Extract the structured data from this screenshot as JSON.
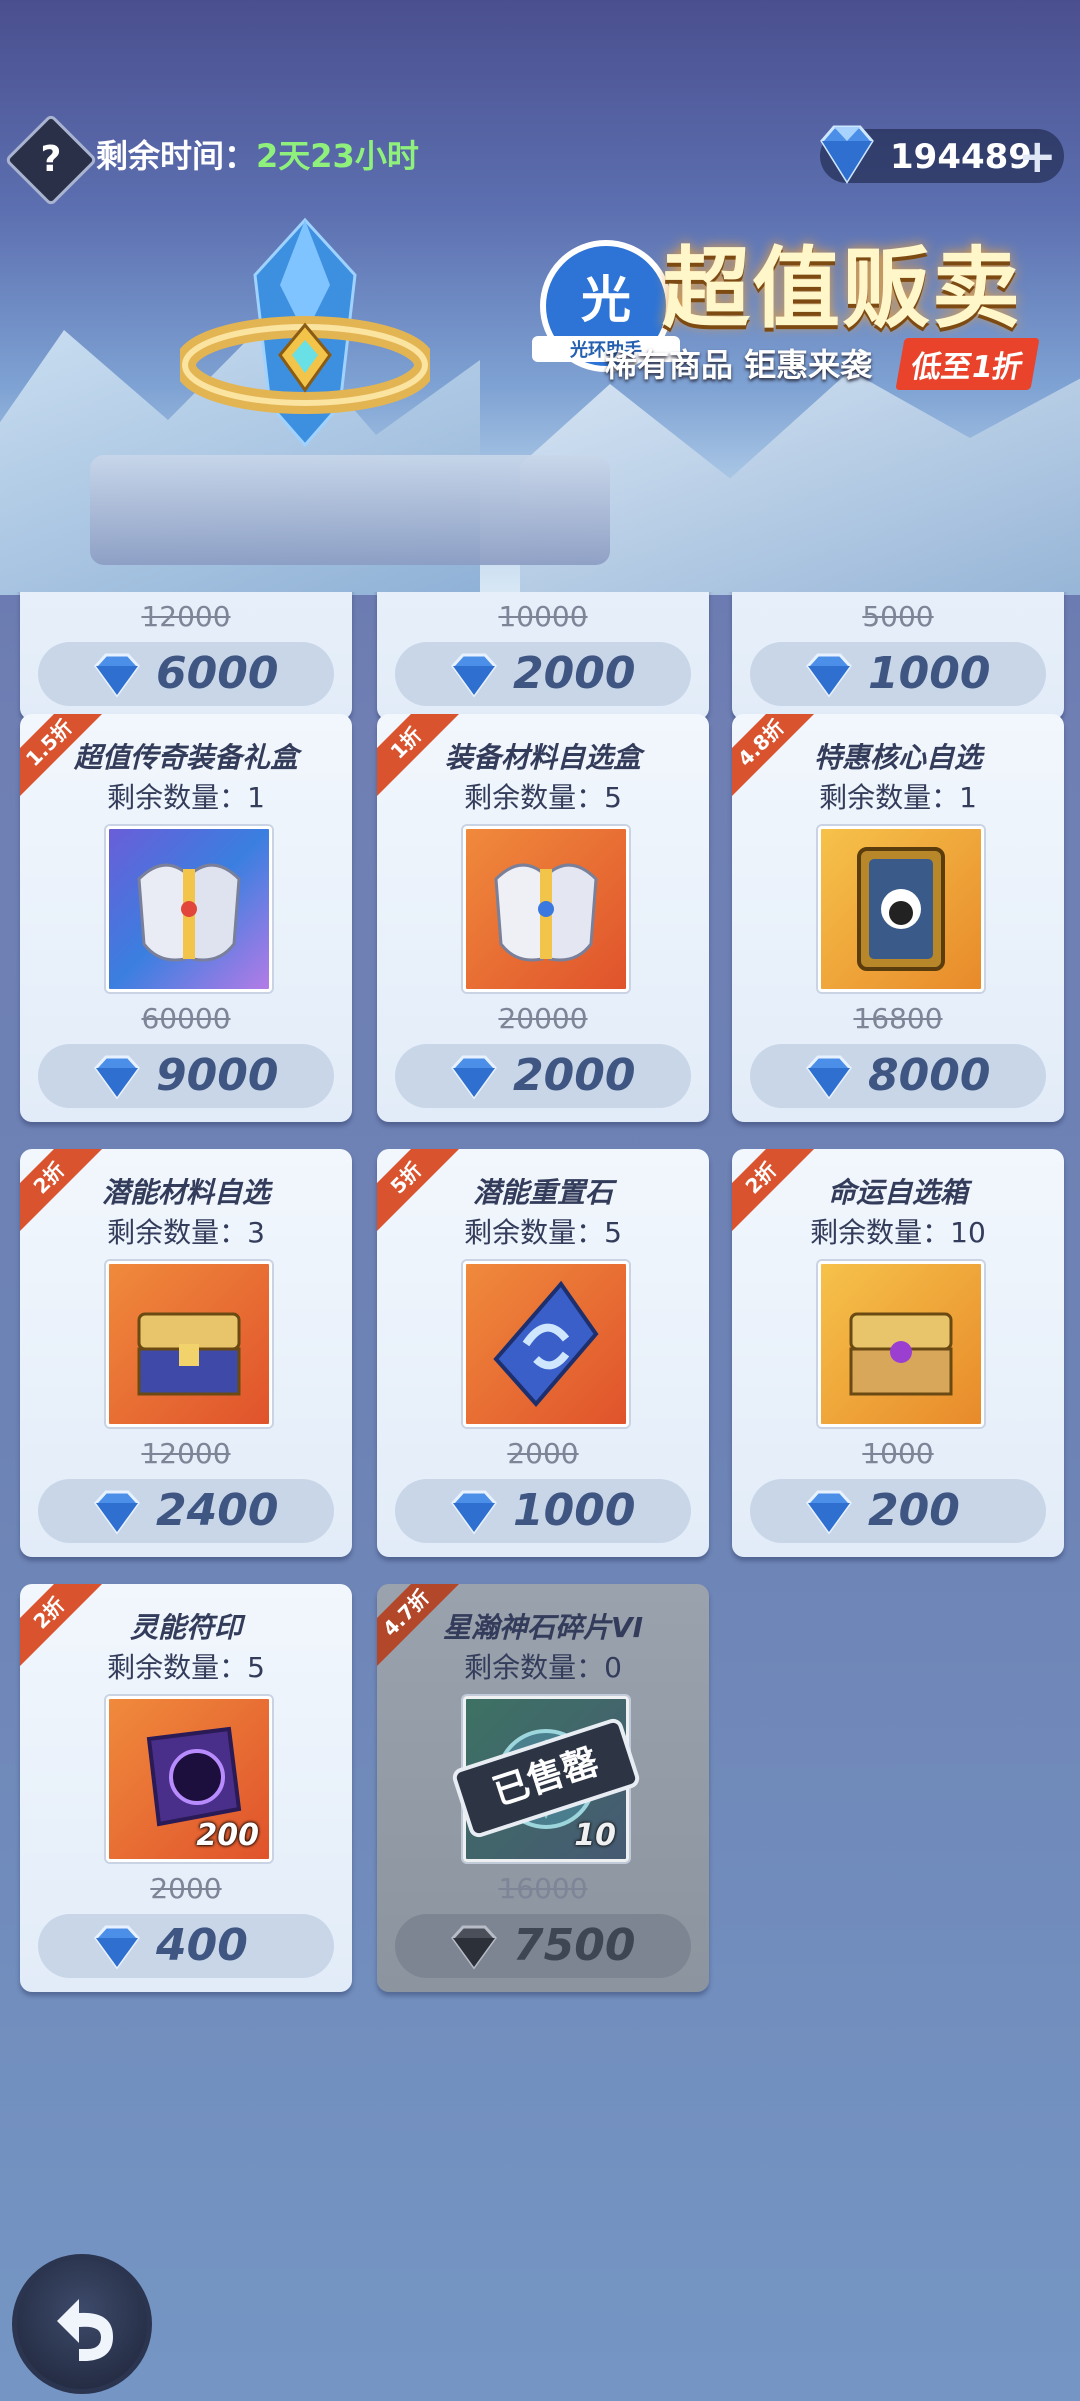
{
  "header": {
    "help_label": "?",
    "timer_label": "剩余时间：",
    "timer_value": "2天23小时",
    "currency_amount": "194489",
    "currency_plus": "+"
  },
  "banner": {
    "title": "超值贩卖",
    "subtitle": "稀有商品 钜惠来袭",
    "tag": "低至1折",
    "watermark_char": "光",
    "watermark_text": "光环助手"
  },
  "top_row_prices": [
    {
      "original": "12000",
      "price": "6000"
    },
    {
      "original": "10000",
      "price": "2000"
    },
    {
      "original": "5000",
      "price": "1000"
    }
  ],
  "items": [
    {
      "discount": "1.5折",
      "name": "超值传奇装备礼盒",
      "qty": "剩余数量：1",
      "original": "60000",
      "price": "9000"
    },
    {
      "discount": "1折",
      "name": "装备材料自选盒",
      "qty": "剩余数量：5",
      "original": "20000",
      "price": "2000"
    },
    {
      "discount": "4.8折",
      "name": "特惠核心自选",
      "qty": "剩余数量：1",
      "original": "16800",
      "price": "8000"
    },
    {
      "discount": "2折",
      "name": "潜能材料自选",
      "qty": "剩余数量：3",
      "original": "12000",
      "price": "2400"
    },
    {
      "discount": "5折",
      "name": "潜能重置石",
      "qty": "剩余数量：5",
      "original": "2000",
      "price": "1000"
    },
    {
      "discount": "2折",
      "name": "命运自选箱",
      "qty": "剩余数量：10",
      "original": "1000",
      "price": "200"
    },
    {
      "discount": "2折",
      "name": "灵能符印",
      "qty": "剩余数量：5",
      "original": "2000",
      "price": "400",
      "stack": "200"
    },
    {
      "discount": "4.7折",
      "name": "星瀚神石碎片VI",
      "qty": "剩余数量：0",
      "original": "16000",
      "price": "7500",
      "stack": "10",
      "sold_label": "已售罄"
    }
  ],
  "icons": {
    "gem": "diamond-gem-icon",
    "back": "return-arrow-icon"
  },
  "colors": {
    "accent_ribbon": "#d9532f",
    "timer_green": "#8ff07c",
    "price_text": "#3f5683"
  }
}
